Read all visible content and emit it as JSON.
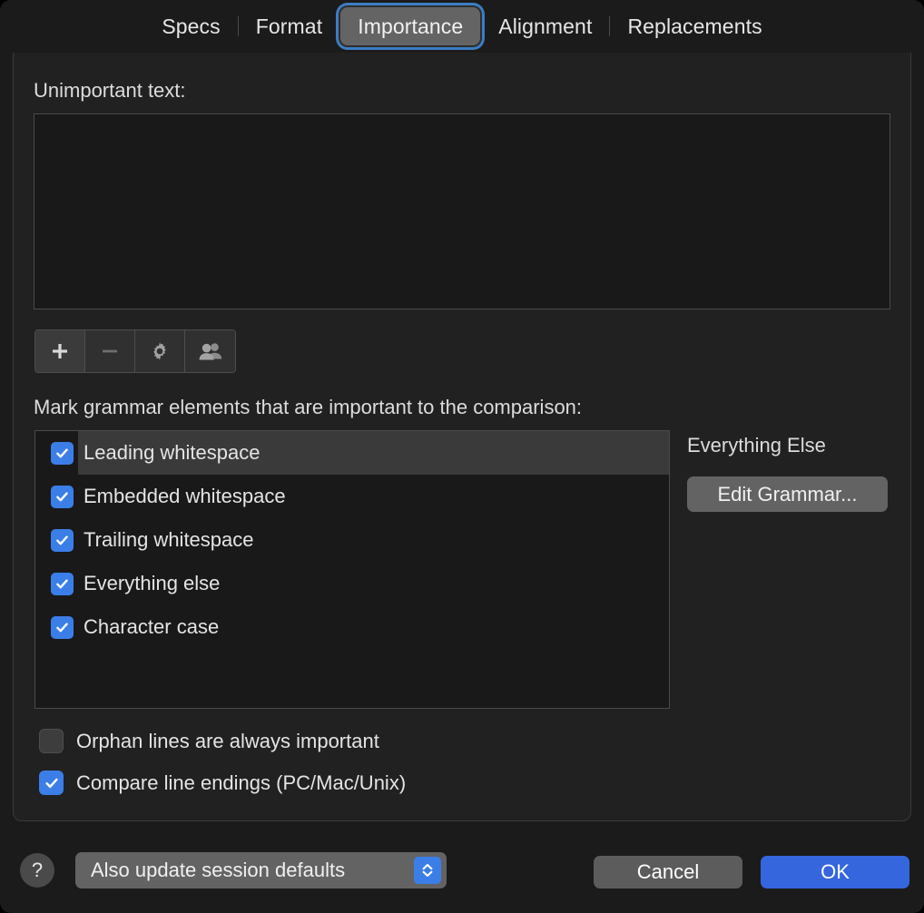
{
  "tabs": [
    {
      "label": "Specs",
      "selected": false
    },
    {
      "label": "Format",
      "selected": false
    },
    {
      "label": "Importance",
      "selected": true
    },
    {
      "label": "Alignment",
      "selected": false
    },
    {
      "label": "Replacements",
      "selected": false
    }
  ],
  "labels": {
    "unimportant_text": "Unimportant text:",
    "mark_grammar": "Mark grammar elements that are important to the comparison:",
    "everything_else": "Everything Else"
  },
  "unimportant_textarea": {
    "value": "",
    "placeholder": ""
  },
  "toolbar": {
    "buttons": [
      {
        "name": "add-button",
        "icon": "plus-icon",
        "state": "active"
      },
      {
        "name": "remove-button",
        "icon": "minus-icon",
        "state": "disabled"
      },
      {
        "name": "settings-button",
        "icon": "gear-icon",
        "state": "normal"
      },
      {
        "name": "group-button",
        "icon": "people-icon",
        "state": "normal"
      }
    ]
  },
  "grammar_list": [
    {
      "label": "Leading whitespace",
      "checked": true,
      "selected": true
    },
    {
      "label": "Embedded whitespace",
      "checked": true,
      "selected": false
    },
    {
      "label": "Trailing whitespace",
      "checked": true,
      "selected": false
    },
    {
      "label": "Everything else",
      "checked": true,
      "selected": false
    },
    {
      "label": "Character case",
      "checked": true,
      "selected": false
    }
  ],
  "edit_grammar_button": "Edit Grammar...",
  "options": [
    {
      "label": "Orphan lines are always important",
      "checked": false
    },
    {
      "label": "Compare line endings (PC/Mac/Unix)",
      "checked": true
    }
  ],
  "footer": {
    "help_label": "?",
    "session_popup_value": "Also update session defaults",
    "cancel_label": "Cancel",
    "ok_label": "OK"
  },
  "colors": {
    "accent_blue": "#3b7ee8",
    "default_button_blue": "#3566dd",
    "focus_ring": "#3b7dc4",
    "window_bg": "#1b1b1b",
    "field_bg": "#191919",
    "selection_row": "#3a3a3a"
  }
}
